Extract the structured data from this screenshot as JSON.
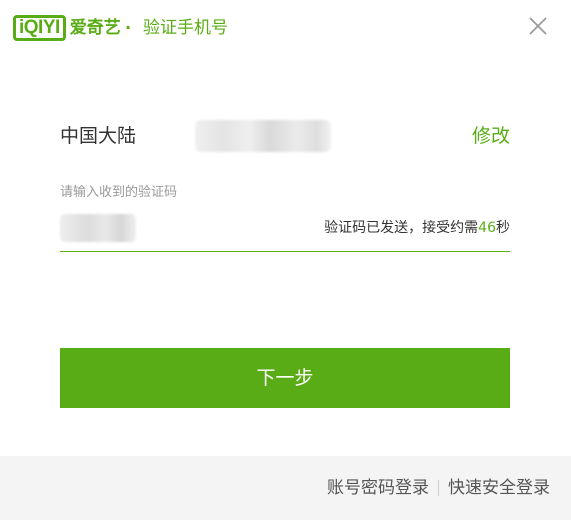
{
  "header": {
    "logo_text": "iQIYI",
    "brand_name": "爱奇艺",
    "separator": "·",
    "title": "验证手机号"
  },
  "region": {
    "label": "中国大陆",
    "modify_label": "修改"
  },
  "verification": {
    "label": "请输入收到的验证码",
    "status_prefix": "验证码已发送，接受约需",
    "countdown": "46",
    "status_suffix": "秒"
  },
  "next_button": {
    "label": "下一步"
  },
  "footer": {
    "password_login": "账号密码登录",
    "quick_login": "快速安全登录"
  },
  "colors": {
    "accent": "#5aac16",
    "footer_bg": "#f4f4f4"
  }
}
